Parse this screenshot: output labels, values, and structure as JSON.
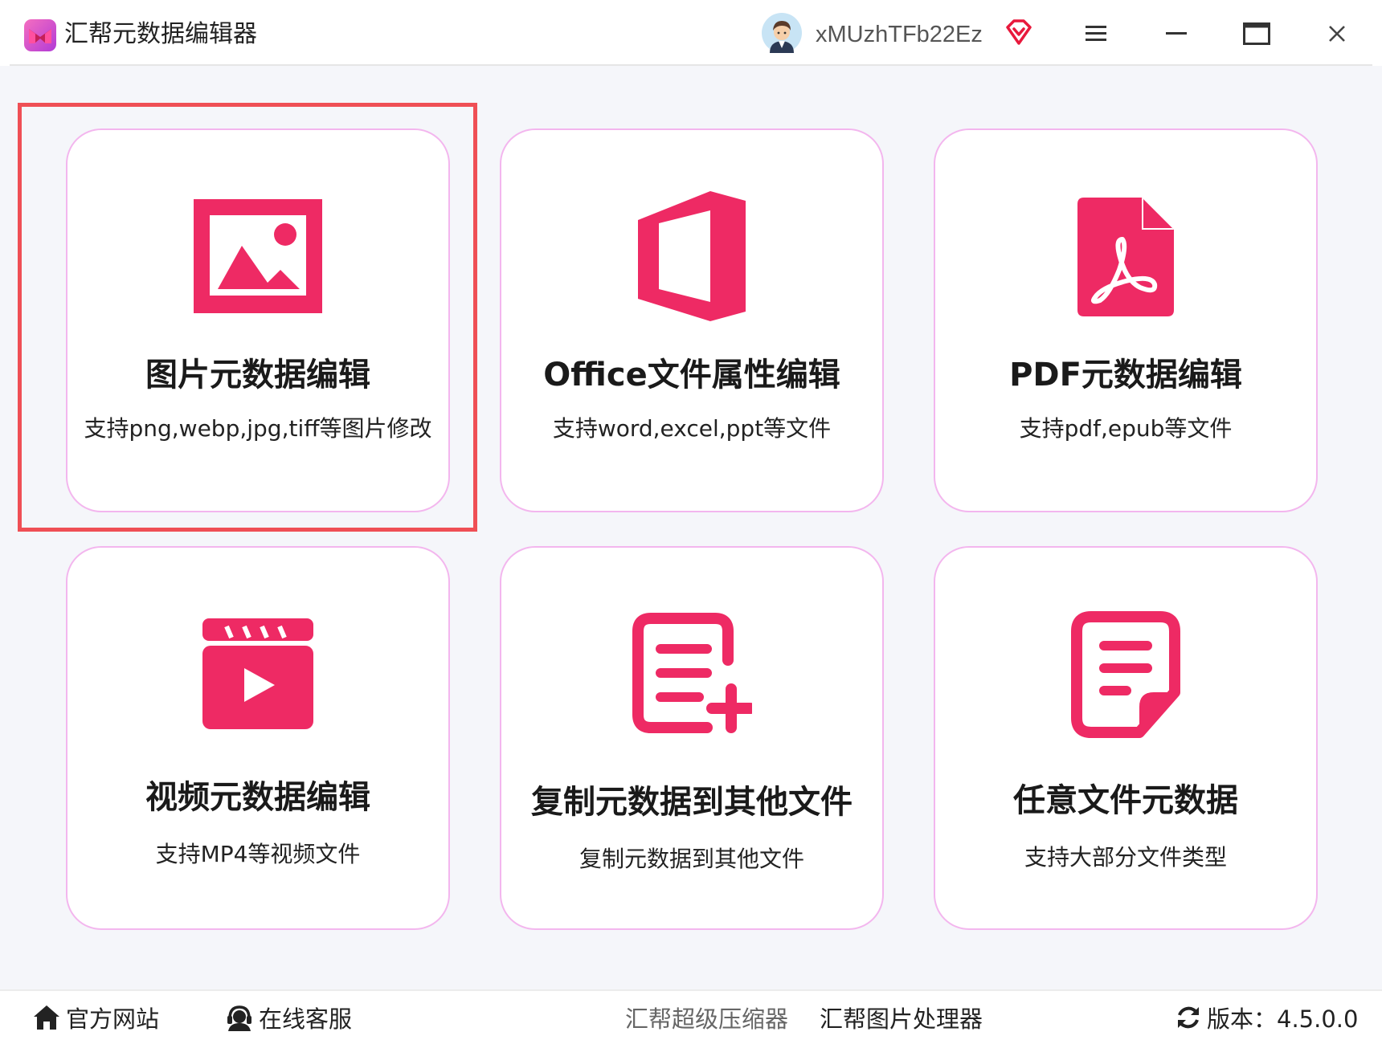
{
  "app": {
    "title": "汇帮元数据编辑器"
  },
  "user": {
    "name": "xMUzhTFb22Ez"
  },
  "colors": {
    "accent": "#ee2a64",
    "card_border": "#f3b6ee",
    "highlight": "#ef4f55"
  },
  "cards": [
    {
      "title": "图片元数据编辑",
      "desc": "支持png,webp,jpg,tiff等图片修改",
      "icon": "image-icon",
      "selected": true
    },
    {
      "title": "Office文件属性编辑",
      "desc": "支持word,excel,ppt等文件",
      "icon": "office-icon",
      "selected": false
    },
    {
      "title": "PDF元数据编辑",
      "desc": "支持pdf,epub等文件",
      "icon": "pdf-icon",
      "selected": false
    },
    {
      "title": "视频元数据编辑",
      "desc": "支持MP4等视频文件",
      "icon": "video-icon",
      "selected": false
    },
    {
      "title": "复制元数据到其他文件",
      "desc": "复制元数据到其他文件",
      "icon": "document-add-icon",
      "selected": false
    },
    {
      "title": "任意文件元数据",
      "desc": "支持大部分文件类型",
      "icon": "file-icon",
      "selected": false
    }
  ],
  "footer": {
    "website": "官方网站",
    "support": "在线客服",
    "compressor": "汇帮超级压缩器",
    "image_processor": "汇帮图片处理器",
    "version": "版本：4.5.0.0"
  }
}
